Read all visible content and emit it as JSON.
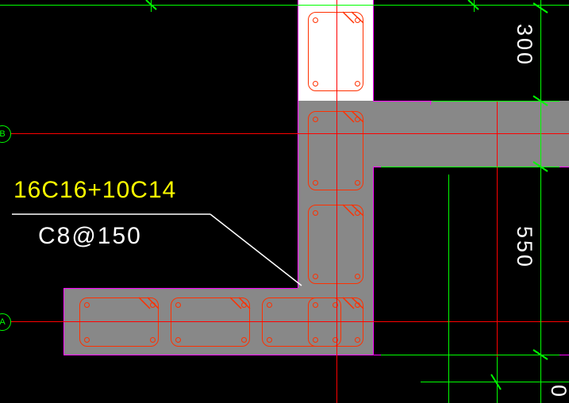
{
  "rebar": {
    "main_spec": "16C16+10C14",
    "stirrup_spec": "C8@150"
  },
  "dimensions": {
    "top": "300",
    "right": "550",
    "bottom_partial": "0"
  },
  "axes": {
    "b_label": "B",
    "a_label": "A"
  },
  "chart_data": {
    "type": "diagram",
    "description": "CAD structural column/beam section detail",
    "dimensions_mm": {
      "upper_segment_height": 300,
      "right_segment_height": 550
    },
    "reinforcement": {
      "longitudinal": [
        {
          "count": 16,
          "bar_type": "C",
          "diameter_mm": 16
        },
        {
          "count": 10,
          "bar_type": "C",
          "diameter_mm": 14
        }
      ],
      "stirrups": {
        "bar_type": "C",
        "diameter_mm": 8,
        "spacing_mm": 150
      }
    },
    "grid_axes": [
      "A",
      "B"
    ]
  }
}
